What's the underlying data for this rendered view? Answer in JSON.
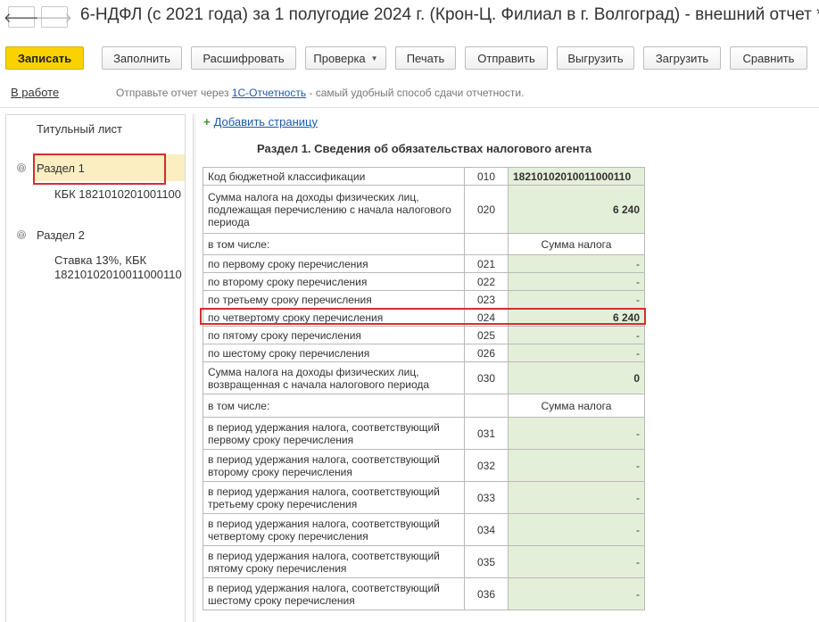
{
  "window": {
    "title": "6-НДФЛ (с 2021 года) за 1 полугодие 2024 г. (Крон-Ц. Филиал в г. Волгоград) - внешний отчет *",
    "back_glyph": "🡐",
    "forward_glyph": "🡒"
  },
  "toolbar": {
    "save": "Записать",
    "fill": "Заполнить",
    "decode": "Расшифровать",
    "check": "Проверка",
    "print": "Печать",
    "send": "Отправить",
    "export": "Выгрузить",
    "import": "Загрузить",
    "compare": "Сравнить"
  },
  "status": {
    "state": "В работе",
    "msg_before": "Отправьте отчет через ",
    "msg_link": "1С-Отчетность",
    "msg_after": " - самый удобный способ сдачи отчетности."
  },
  "sidebar": {
    "items": [
      {
        "label": "Титульный лист"
      },
      {
        "label": "Раздел 1",
        "toggle": "⊖"
      },
      {
        "label": "КБК 1821010201001100"
      },
      {
        "label": "Раздел 2",
        "toggle": "⊖"
      },
      {
        "label": "Ставка 13%, КБК"
      },
      {
        "label": "18210102010011000110"
      }
    ]
  },
  "main": {
    "add_page": "Добавить страницу",
    "add_plus": "+",
    "section_title": "Раздел 1. Сведения об обязательствах налогового агента",
    "kbk_row": {
      "label": "Код бюджетной классификации",
      "code": "010",
      "value": "18210102010011000110"
    },
    "row_020": {
      "label": "Сумма налога на доходы физических лиц, подлежащая перечислению с начала налогового периода",
      "code": "020",
      "value": "6 240"
    },
    "subheader_1": {
      "label": "в том числе:",
      "col": "Сумма налога"
    },
    "rows_02x": [
      {
        "label": "по первому сроку перечисления",
        "code": "021",
        "value": "-"
      },
      {
        "label": "по второму сроку перечисления",
        "code": "022",
        "value": "-"
      },
      {
        "label": "по третьему сроку перечисления",
        "code": "023",
        "value": "-"
      },
      {
        "label": "по четвертому сроку перечисления",
        "code": "024",
        "value": "6 240"
      },
      {
        "label": "по пятому сроку перечисления",
        "code": "025",
        "value": "-"
      },
      {
        "label": "по шестому сроку перечисления",
        "code": "026",
        "value": "-"
      }
    ],
    "row_030": {
      "label": "Сумма налога на доходы физических лиц, возвращенная с начала налогового периода",
      "code": "030",
      "value": "0"
    },
    "subheader_2": {
      "label": "в том числе:",
      "col": "Сумма налога"
    },
    "rows_03x": [
      {
        "label": "в период удержания налога, соответствующий первому сроку перечисления",
        "code": "031",
        "value": "-"
      },
      {
        "label": "в период удержания налога, соответствующий второму сроку перечисления",
        "code": "032",
        "value": "-"
      },
      {
        "label": "в период удержания налога, соответствующий третьему сроку перечисления",
        "code": "033",
        "value": "-"
      },
      {
        "label": "в период удержания налога, соответствующий четвертому сроку перечисления",
        "code": "034",
        "value": "-"
      },
      {
        "label": "в период удержания налога, соответствующий пятому сроку перечисления",
        "code": "035",
        "value": "-"
      },
      {
        "label": "в период удержания налога, соответствующий шестому сроку перечисления",
        "code": "036",
        "value": "-"
      }
    ]
  }
}
